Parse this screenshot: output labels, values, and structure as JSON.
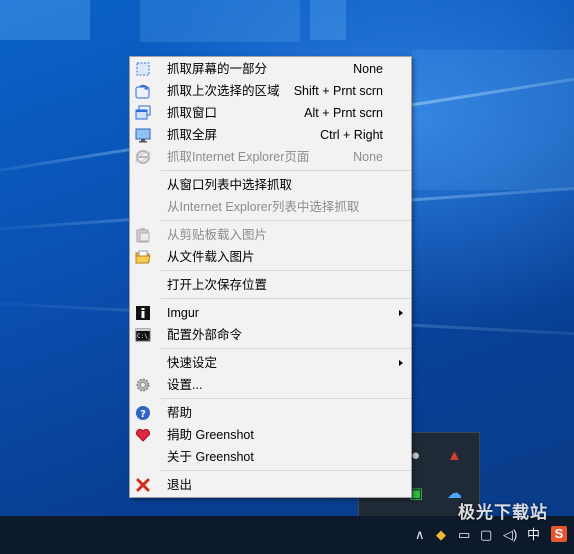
{
  "menu": {
    "items": [
      {
        "label": "抓取屏幕的一部分",
        "shortcut": "None",
        "icon": "region-select-icon",
        "enabled": true
      },
      {
        "label": "抓取上次选择的区域",
        "shortcut": "Shift + Prnt scrn",
        "icon": "last-region-icon",
        "enabled": true
      },
      {
        "label": "抓取窗口",
        "shortcut": "Alt + Prnt scrn",
        "icon": "window-capture-icon",
        "enabled": true
      },
      {
        "label": "抓取全屏",
        "shortcut": "Ctrl + Right",
        "icon": "fullscreen-monitor-icon",
        "enabled": true
      },
      {
        "label": "抓取Internet Explorer页面",
        "shortcut": "None",
        "icon": "internet-explorer-icon",
        "enabled": false
      },
      {
        "label": "从窗口列表中选择抓取",
        "shortcut": "",
        "icon": "",
        "enabled": true
      },
      {
        "label": "从Internet Explorer列表中选择抓取",
        "shortcut": "",
        "icon": "",
        "enabled": false
      },
      {
        "label": "从剪贴板载入图片",
        "shortcut": "",
        "icon": "clipboard-icon",
        "enabled": false
      },
      {
        "label": "从文件载入图片",
        "shortcut": "",
        "icon": "open-folder-icon",
        "enabled": true
      },
      {
        "label": "打开上次保存位置",
        "shortcut": "",
        "icon": "",
        "enabled": true
      },
      {
        "label": "Imgur",
        "shortcut": "",
        "icon": "imgur-icon",
        "enabled": true,
        "submenu": true
      },
      {
        "label": "配置外部命令",
        "shortcut": "",
        "icon": "command-prompt-icon",
        "enabled": true
      },
      {
        "label": "快速设定",
        "shortcut": "",
        "icon": "",
        "enabled": true,
        "submenu": true
      },
      {
        "label": "设置...",
        "shortcut": "",
        "icon": "settings-gear-icon",
        "enabled": true
      },
      {
        "label": "帮助",
        "shortcut": "",
        "icon": "help-icon",
        "enabled": true
      },
      {
        "label": "捐助 Greenshot",
        "shortcut": "",
        "icon": "heart-icon",
        "enabled": true
      },
      {
        "label": "关于 Greenshot",
        "shortcut": "",
        "icon": "",
        "enabled": true
      },
      {
        "label": "退出",
        "shortcut": "",
        "icon": "exit-x-icon",
        "enabled": true
      }
    ]
  },
  "taskbar": {
    "ime": "中",
    "watermark": "极光下载站",
    "sogou_label": "S"
  },
  "colors": {
    "accent": "#0a57b8",
    "menu_bg": "#f2f2f2",
    "disabled_text": "#8d8d8d",
    "taskbar": "#0c1a2c"
  }
}
